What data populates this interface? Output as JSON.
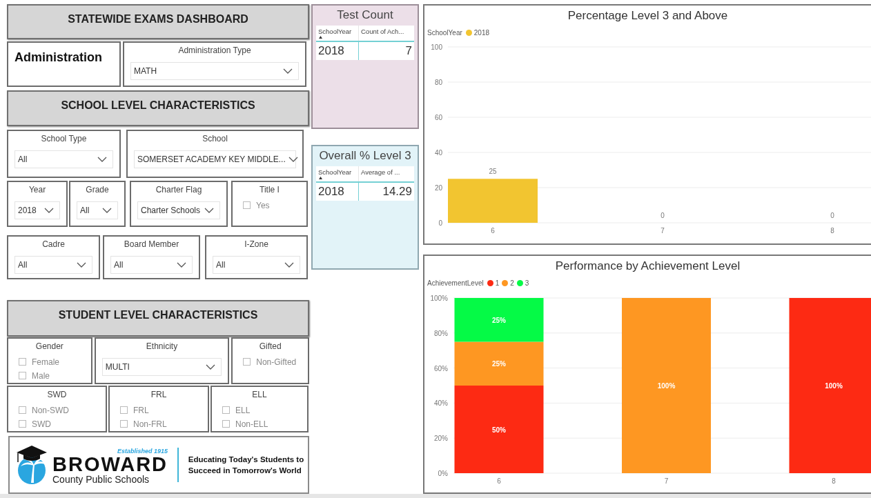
{
  "sections": [
    {
      "title": "STATEWIDE EXAMS DASHBOARD",
      "filters": [
        {
          "kind": "label",
          "text": "Administration"
        },
        {
          "kind": "dropdown",
          "label": "Administration Type",
          "value": "MATH"
        }
      ]
    },
    {
      "title": "SCHOOL LEVEL CHARACTERISTICS",
      "filters": [
        {
          "kind": "dropdown",
          "label": "School Type",
          "value": "All"
        },
        {
          "kind": "dropdown",
          "label": "School",
          "value": "SOMERSET ACADEMY KEY MIDDLE..."
        },
        {
          "kind": "dropdown",
          "label": "Year",
          "value": "2018"
        },
        {
          "kind": "dropdown",
          "label": "Grade",
          "value": "All"
        },
        {
          "kind": "dropdown",
          "label": "Charter Flag",
          "value": "Charter Schools"
        },
        {
          "kind": "checklist",
          "label": "Title I",
          "options": [
            {
              "label": "Yes",
              "checked": false
            }
          ]
        },
        {
          "kind": "dropdown",
          "label": "Cadre",
          "value": "All"
        },
        {
          "kind": "dropdown",
          "label": "Board Member",
          "value": "All"
        },
        {
          "kind": "dropdown",
          "label": "I-Zone",
          "value": "All"
        }
      ]
    },
    {
      "title": "STUDENT LEVEL CHARACTERISTICS",
      "filters": [
        {
          "kind": "checklist",
          "label": "Gender",
          "options": [
            {
              "label": "Female",
              "checked": false
            },
            {
              "label": "Male",
              "checked": false
            }
          ]
        },
        {
          "kind": "dropdown",
          "label": "Ethnicity",
          "value": "MULTI"
        },
        {
          "kind": "checklist",
          "label": "Gifted",
          "options": [
            {
              "label": "Non-Gifted",
              "checked": false
            }
          ]
        },
        {
          "kind": "checklist",
          "label": "SWD",
          "options": [
            {
              "label": "Non-SWD",
              "checked": false
            },
            {
              "label": "SWD",
              "checked": false
            }
          ]
        },
        {
          "kind": "checklist",
          "label": "FRL",
          "options": [
            {
              "label": "FRL",
              "checked": false
            },
            {
              "label": "Non-FRL",
              "checked": false
            }
          ]
        },
        {
          "kind": "checklist",
          "label": "ELL",
          "options": [
            {
              "label": "ELL",
              "checked": false
            },
            {
              "label": "Non-ELL",
              "checked": false
            }
          ]
        }
      ]
    }
  ],
  "logo": {
    "established": "Established 1915",
    "name": "BROWARD",
    "subtitle": "County Public Schools",
    "tagline": "Educating Today's Students to Succeed in Tomorrow's World"
  },
  "cards": [
    {
      "title": "Test Count",
      "columns": [
        "SchoolYear",
        "Count of Ach..."
      ],
      "rows": [
        [
          "2018",
          "7"
        ]
      ]
    },
    {
      "title": "Overall % Level 3",
      "columns": [
        "SchoolYear",
        "Average of ..."
      ],
      "rows": [
        [
          "2018",
          "14.29"
        ]
      ]
    }
  ],
  "charts": [
    {
      "legend_title": "SchoolYear",
      "chart_data": {
        "type": "bar",
        "title": "Percentage Level 3 and Above",
        "categories": [
          "6",
          "7",
          "8"
        ],
        "series": [
          {
            "name": "2018",
            "color": "#f2c530",
            "values": [
              25,
              0,
              0
            ]
          }
        ],
        "ylim": [
          0,
          100
        ],
        "yticks": [
          0,
          20,
          40,
          60,
          80,
          100
        ],
        "grid": true,
        "legend": true,
        "value_labels": [
          [
            "25",
            "0",
            "0"
          ]
        ]
      }
    },
    {
      "legend_title": "AchievementLevel",
      "chart_data": {
        "type": "bar",
        "title": "Performance by Achievement Level",
        "stacked": true,
        "categories": [
          "6",
          "7",
          "8"
        ],
        "series": [
          {
            "name": "1",
            "color": "#fd2a13",
            "values": [
              50,
              0,
              100
            ]
          },
          {
            "name": "2",
            "color": "#fe9722",
            "values": [
              25,
              100,
              0
            ]
          },
          {
            "name": "3",
            "color": "#05fa46",
            "values": [
              25,
              0,
              0
            ]
          }
        ],
        "ylim": [
          0,
          100
        ],
        "yticks": [
          {
            "value": 0,
            "label": "0%"
          },
          {
            "value": 20,
            "label": "20%"
          },
          {
            "value": 40,
            "label": "40%"
          },
          {
            "value": 60,
            "label": "60%"
          },
          {
            "value": 80,
            "label": "80%"
          },
          {
            "value": 100,
            "label": "100%"
          }
        ],
        "grid": true,
        "legend": true,
        "value_labels": [
          [
            "50%",
            null,
            "100%"
          ],
          [
            "25%",
            "100%",
            null
          ],
          [
            "25%",
            null,
            null
          ]
        ]
      }
    }
  ]
}
